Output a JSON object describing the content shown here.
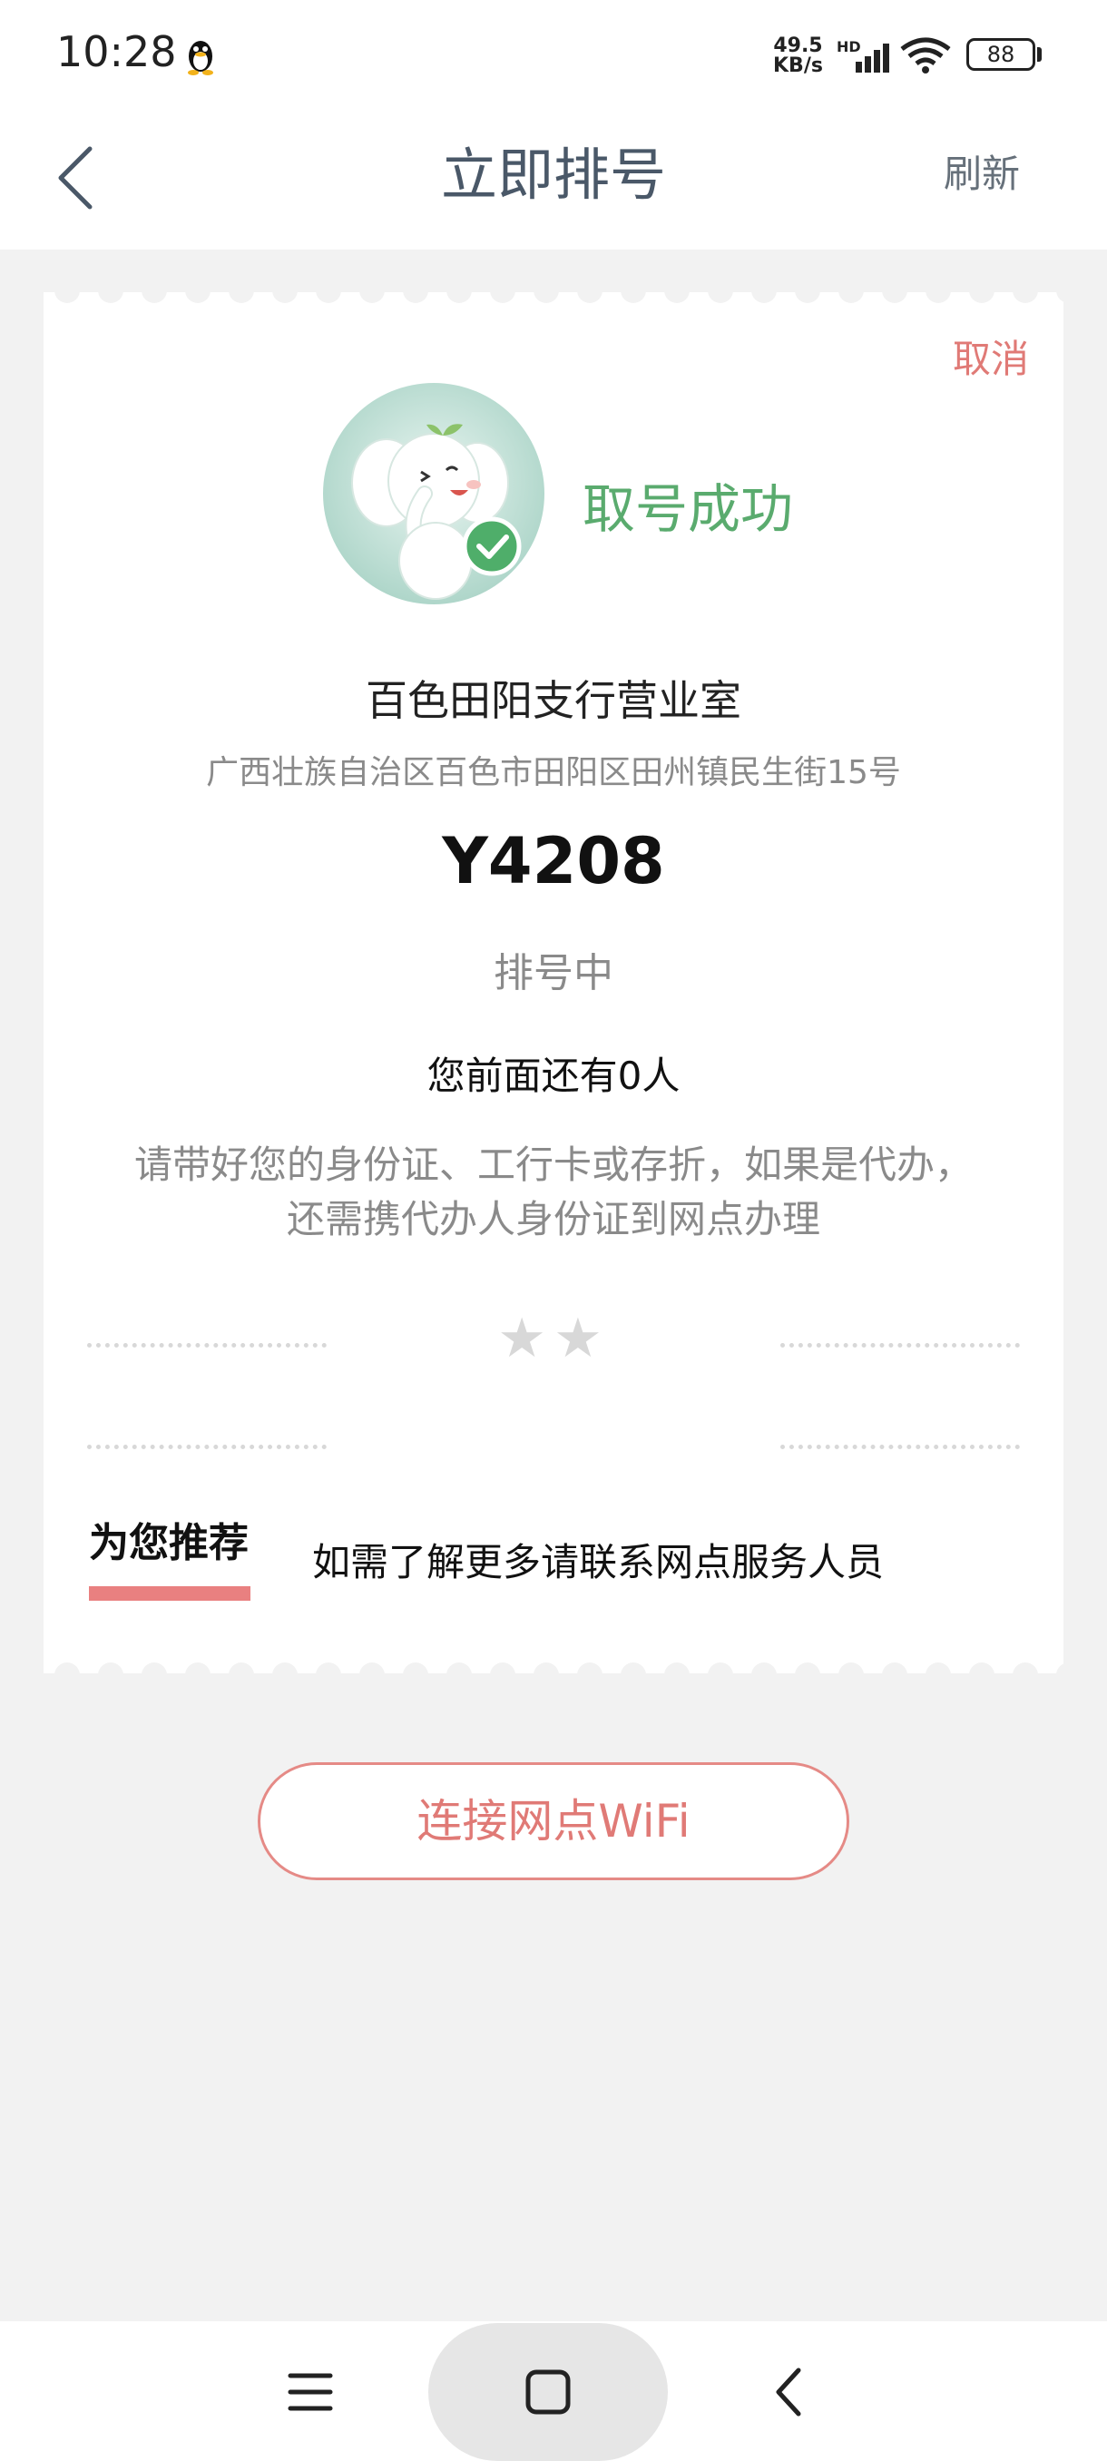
{
  "status_bar": {
    "time": "10:28",
    "net_speed_value": "49.5",
    "net_speed_unit": "KB/s",
    "network_type": "HD",
    "battery": "88"
  },
  "header": {
    "title": "立即排号",
    "refresh_label": "刷新"
  },
  "ticket": {
    "cancel_label": "取消",
    "success_text": "取号成功",
    "branch_name": "百色田阳支行营业室",
    "branch_address": "广西壮族自治区百色市田阳区田州镇民生街15号",
    "number": "Y4208",
    "status": "排号中",
    "people_ahead": "您前面还有0人",
    "notice_line1": "请带好您的身份证、工行卡或存折，如果是代办，",
    "notice_line2": "还需携代办人身份证到网点办理",
    "stars": "★★",
    "recommend_tab": "为您推荐",
    "recommend_text": "如需了解更多请联系网点服务人员"
  },
  "wifi_button_label": "连接网点WiFi",
  "colors": {
    "accent_red": "#e07a76",
    "success_green": "#5aab6e",
    "title_slate": "#4a5868",
    "page_bg": "#f2f2f2"
  },
  "icons": {
    "back": "chevron-left-icon",
    "qq": "qq-penguin-icon",
    "signal": "signal-bars-icon",
    "wifi": "wifi-icon",
    "battery": "battery-icon",
    "mascot": "elephant-mascot-check-icon",
    "nav_menu": "menu-lines-icon",
    "nav_home": "square-home-icon",
    "nav_back": "chevron-left-icon"
  }
}
